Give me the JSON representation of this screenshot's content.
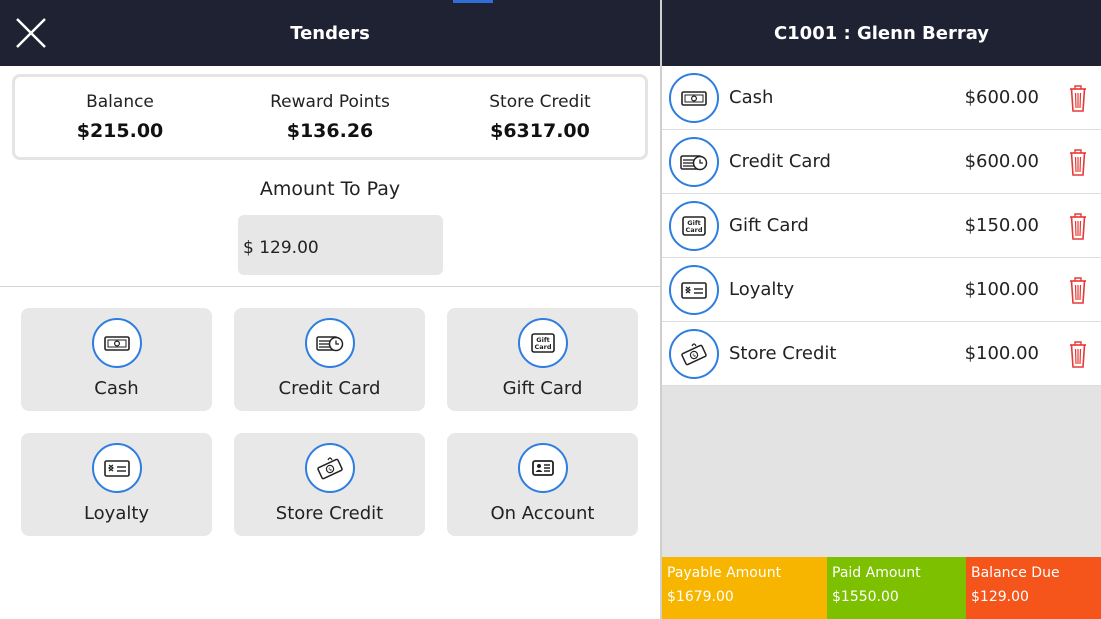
{
  "left_header": {
    "title": "Tenders"
  },
  "balances": [
    {
      "label": "Balance",
      "value": "$215.00"
    },
    {
      "label": "Reward Points",
      "value": "$136.26"
    },
    {
      "label": "Store Credit",
      "value": "$6317.00"
    }
  ],
  "amount_to_pay": {
    "label": "Amount To Pay",
    "value": "$ 129.00"
  },
  "tenders": [
    {
      "label": "Cash",
      "icon": "cash-icon"
    },
    {
      "label": "Credit Card",
      "icon": "credit-card-icon"
    },
    {
      "label": "Gift Card",
      "icon": "gift-card-icon"
    },
    {
      "label": "Loyalty",
      "icon": "loyalty-icon"
    },
    {
      "label": "Store Credit",
      "icon": "store-credit-icon"
    },
    {
      "label": "On Account",
      "icon": "on-account-icon"
    }
  ],
  "right_header": {
    "title": "C1001 : Glenn Berray"
  },
  "payments": [
    {
      "name": "Cash",
      "amount": "$600.00",
      "icon": "cash-icon"
    },
    {
      "name": "Credit Card",
      "amount": "$600.00",
      "icon": "credit-card-icon"
    },
    {
      "name": "Gift Card",
      "amount": "$150.00",
      "icon": "gift-card-icon"
    },
    {
      "name": "Loyalty",
      "amount": "$100.00",
      "icon": "loyalty-icon"
    },
    {
      "name": "Store Credit",
      "amount": "$100.00",
      "icon": "store-credit-icon"
    }
  ],
  "summary": {
    "payable_label": "Payable Amount",
    "payable_value": "$1679.00",
    "paid_label": "Paid Amount",
    "paid_value": "$1550.00",
    "due_label": "Balance Due",
    "due_value": "$129.00"
  },
  "gift_icon_text": {
    "line1": "Gift",
    "line2": "Card"
  },
  "colors": {
    "header": "#1f2233",
    "icon_ring": "#2e7de0",
    "delete": "#e53935",
    "payable": "#f7b500",
    "paid": "#7cc000",
    "due": "#f5541b"
  }
}
